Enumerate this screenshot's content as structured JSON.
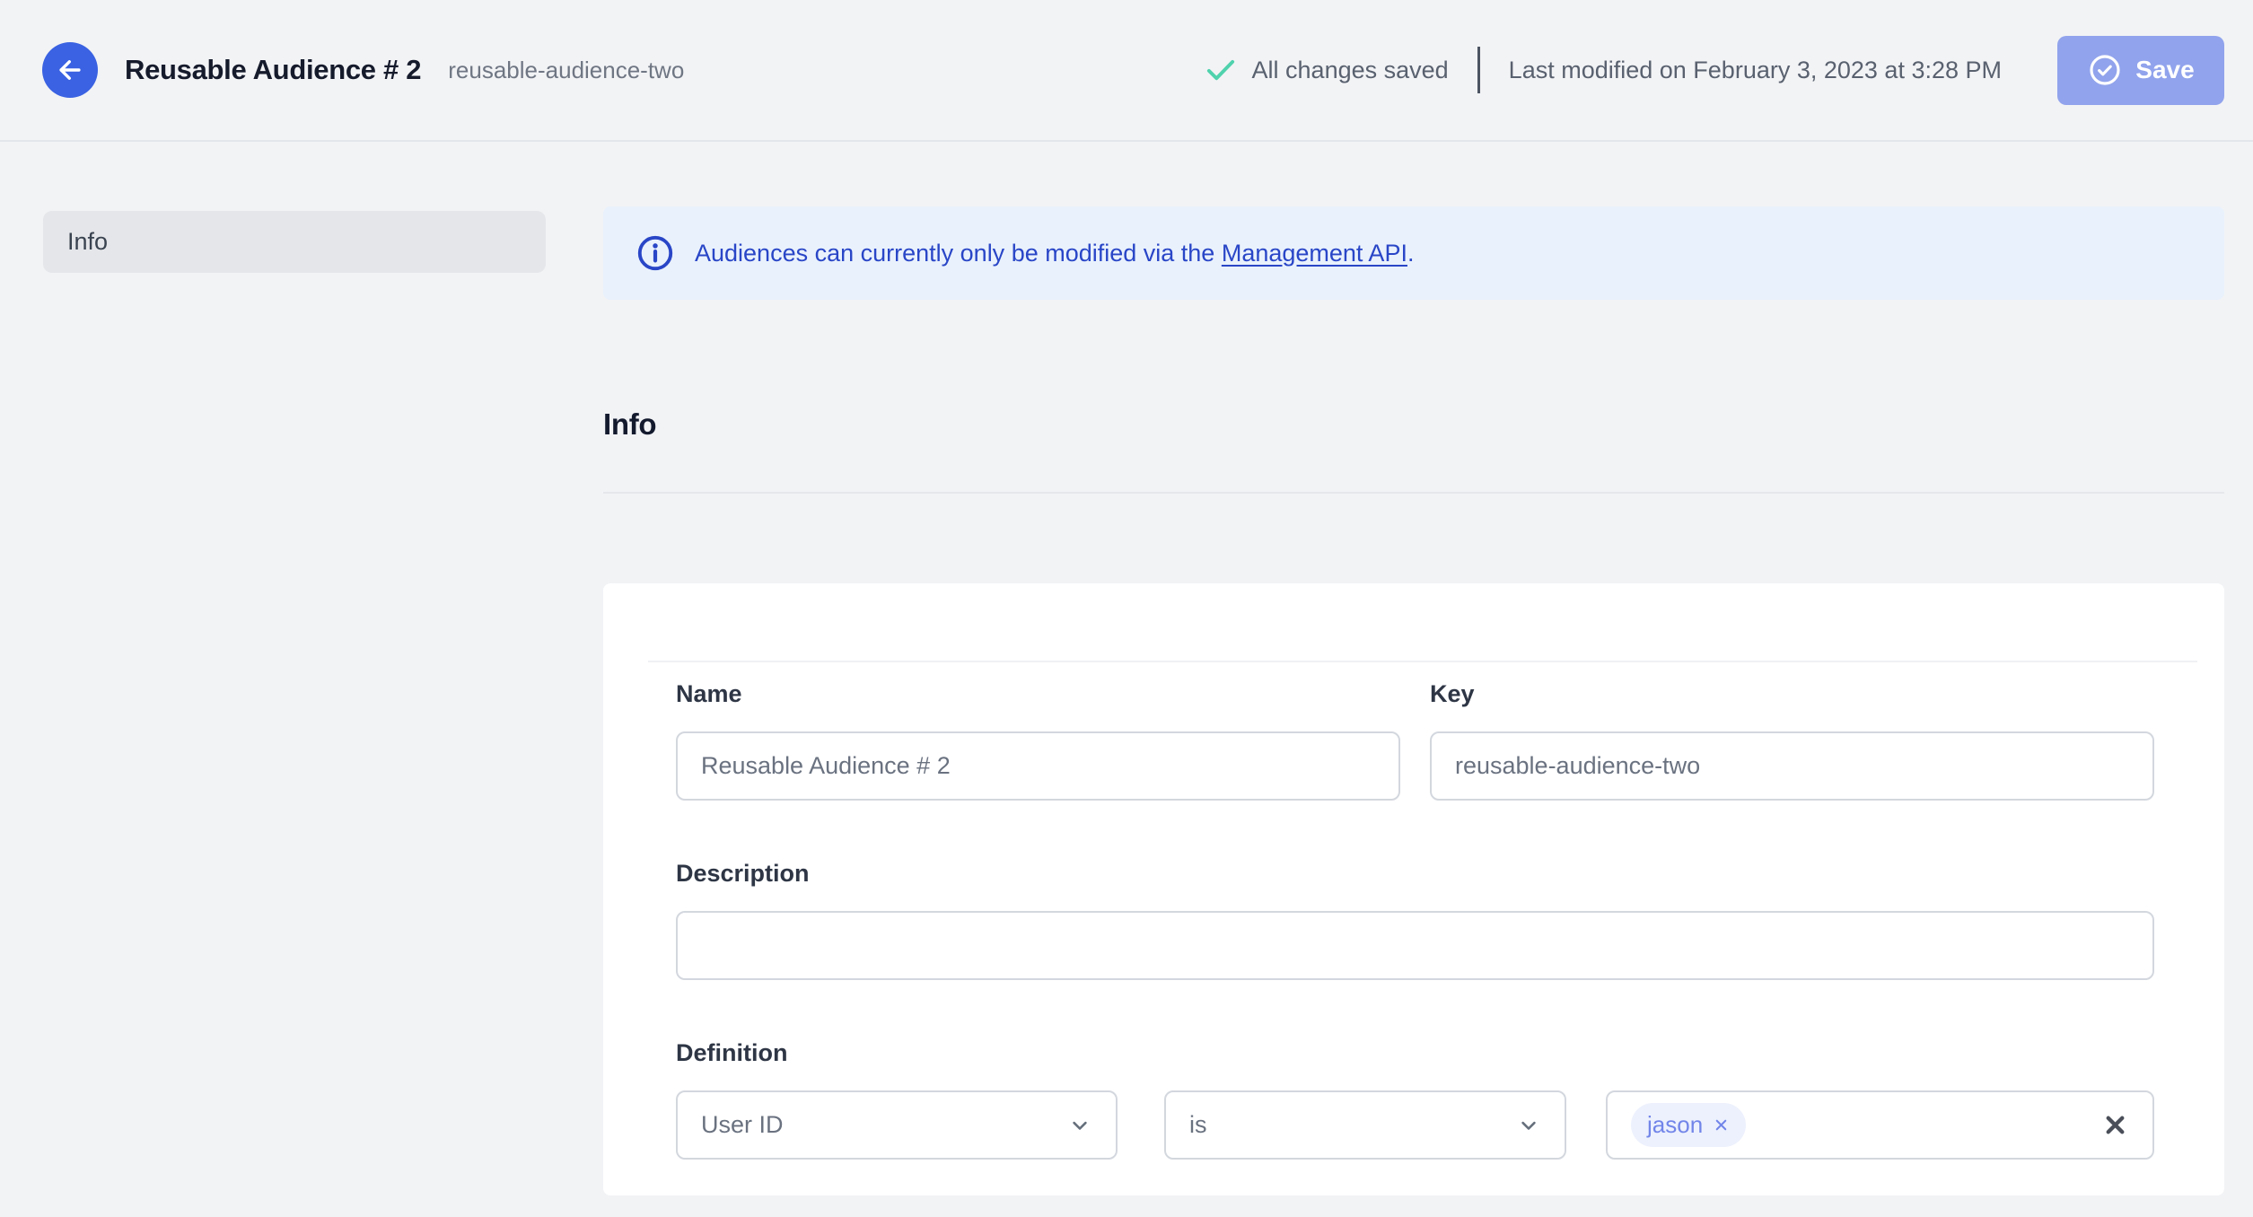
{
  "header": {
    "title": "Reusable Audience # 2",
    "slug": "reusable-audience-two",
    "status": "All changes saved",
    "last_modified": "Last modified on February 3, 2023 at 3:28 PM",
    "save_label": "Save"
  },
  "sidebar": {
    "items": [
      {
        "label": "Info",
        "active": true
      }
    ]
  },
  "banner": {
    "text_before": "Audiences can currently only be modified via the ",
    "link_label": "Management API",
    "text_after": "."
  },
  "section": {
    "title": "Info"
  },
  "form": {
    "name": {
      "label": "Name",
      "value": "Reusable Audience # 2"
    },
    "key": {
      "label": "Key",
      "value": "reusable-audience-two"
    },
    "description": {
      "label": "Description",
      "value": ""
    },
    "definition": {
      "label": "Definition",
      "trait": "User ID",
      "operator": "is",
      "values": [
        "jason"
      ]
    }
  },
  "icons": {
    "back": "back-arrow-icon",
    "saved": "check-icon",
    "save_button": "circle-check-icon",
    "banner": "info-circle-icon",
    "selects": "chevron-down-icon",
    "chip_remove": "x-icon",
    "clear_field": "x-icon"
  },
  "colors": {
    "page_background": "#F2F3F5",
    "back_button": "#3A62E2",
    "save_button": "#91A3EC",
    "saved_check": "#4FD2AD",
    "banner_background": "#E9F1FC",
    "banner_text": "#2946C7",
    "chip_background": "#EDF1FD",
    "chip_text": "#7285E9",
    "input_border": "#D3D7DE",
    "muted_text": "#6A7280",
    "title_text": "#161B2C"
  }
}
